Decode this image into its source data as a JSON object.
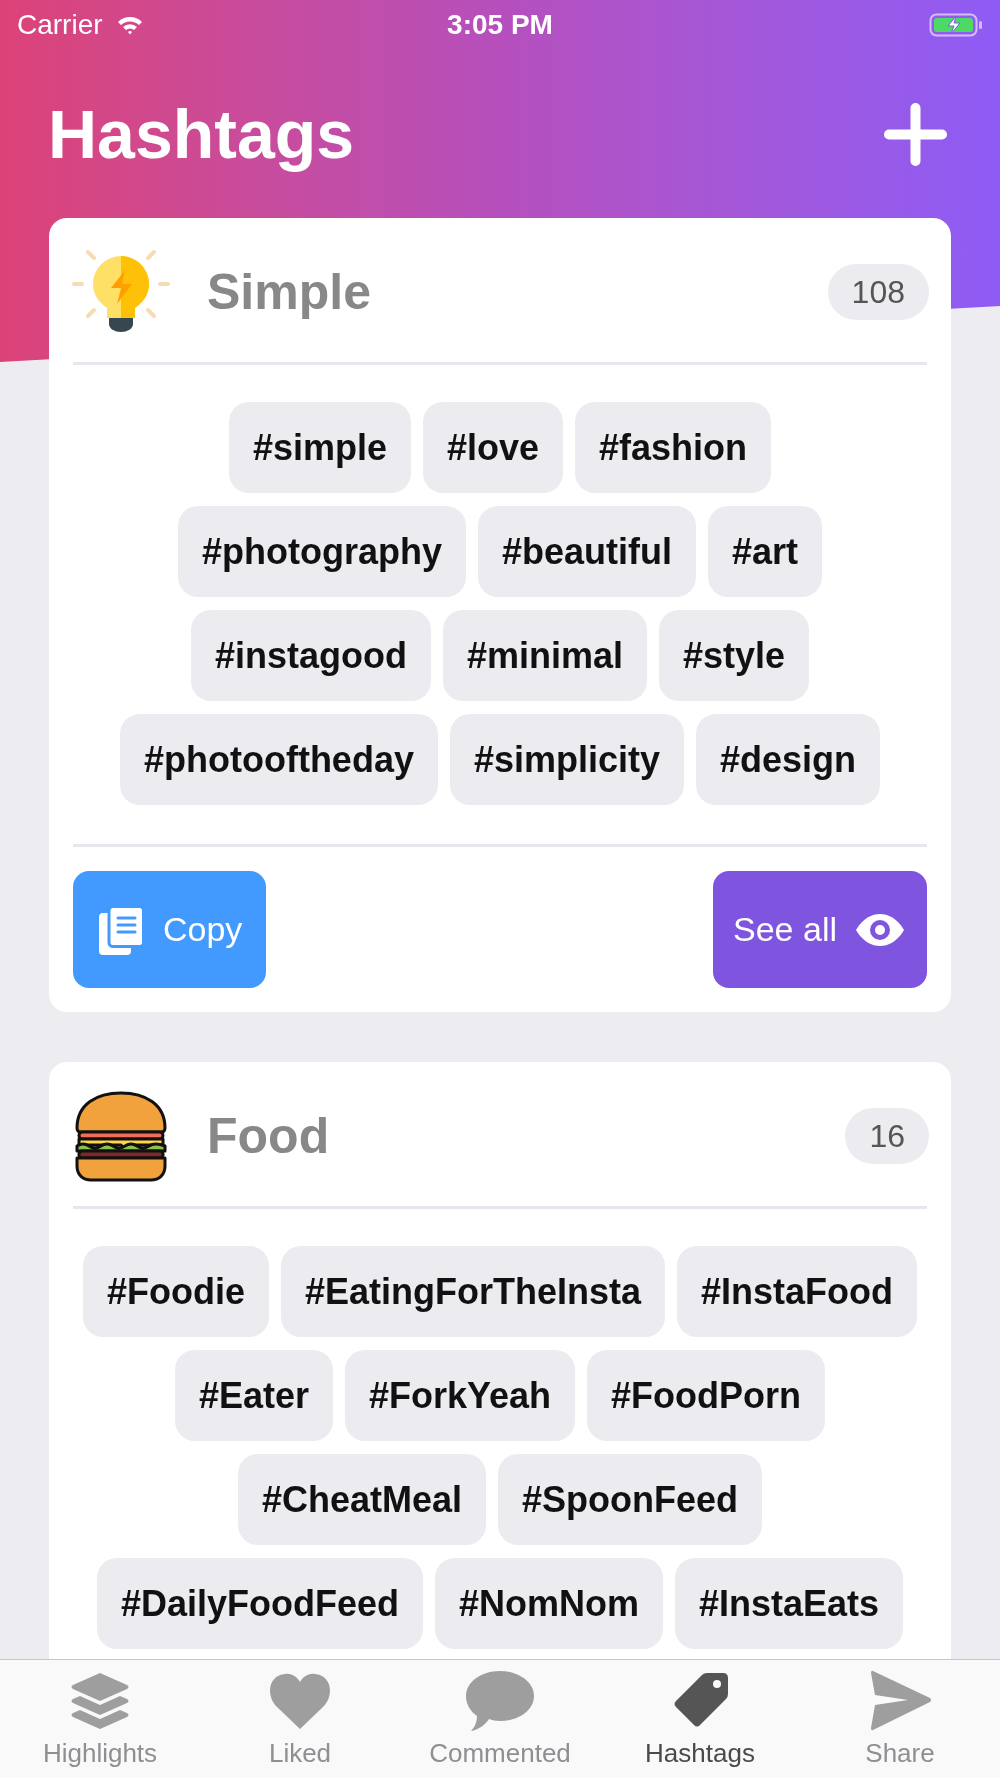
{
  "status_bar": {
    "carrier": "Carrier",
    "time": "3:05 PM"
  },
  "header": {
    "title": "Hashtags"
  },
  "groups": [
    {
      "title": "Simple",
      "count": "108",
      "tag_rows": [
        [
          "#simple",
          "#love",
          "#fashion"
        ],
        [
          "#photography",
          "#beautiful",
          "#art"
        ],
        [
          "#instagood",
          "#minimal",
          "#style"
        ],
        [
          "#photooftheday",
          "#simplicity",
          "#design"
        ]
      ],
      "actions": [
        {
          "kind": "copy",
          "label": "Copy"
        },
        {
          "kind": "see_all",
          "label": "See all"
        }
      ]
    },
    {
      "title": "Food",
      "count": "16",
      "tag_rows": [
        [
          "#Foodie",
          "#EatingForTheInsta",
          "#InstaFood"
        ],
        [
          "#Eater",
          "#ForkYeah",
          "#FoodPorn"
        ],
        [
          "#CheatMeal",
          "#SpoonFeed"
        ],
        [
          "#DailyFoodFeed",
          "#NomNom",
          "#InstaEats"
        ]
      ]
    }
  ],
  "tab_bar": {
    "items": [
      {
        "label": "Highlights",
        "selected": false
      },
      {
        "label": "Liked",
        "selected": false
      },
      {
        "label": "Commented",
        "selected": false
      },
      {
        "label": "Hashtags",
        "selected": true
      },
      {
        "label": "Share",
        "selected": false
      }
    ]
  }
}
